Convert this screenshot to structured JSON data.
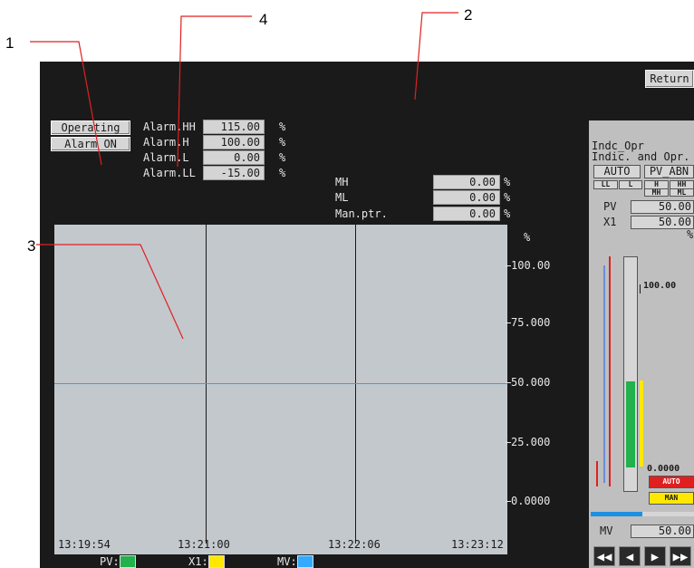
{
  "callouts": {
    "c1": "1",
    "c2": "2",
    "c3": "3",
    "c4": "4"
  },
  "header": {
    "return_label": "Return"
  },
  "status": {
    "operating_label": "Operating",
    "alarm_on_label": "Alarm ON"
  },
  "alarms": [
    {
      "label": "Alarm.HH",
      "value": "115.00",
      "unit": "%"
    },
    {
      "label": "Alarm.H",
      "value": "100.00",
      "unit": "%"
    },
    {
      "label": "Alarm.L",
      "value": "0.00",
      "unit": "%"
    },
    {
      "label": "Alarm.LL",
      "value": "-15.00",
      "unit": "%"
    }
  ],
  "limits": [
    {
      "label": "MH",
      "value": "0.00",
      "unit": "%"
    },
    {
      "label": "ML",
      "value": "0.00",
      "unit": "%"
    },
    {
      "label": "Man.ptr.",
      "value": "0.00",
      "unit": "%"
    }
  ],
  "trend": {
    "y_unit": "%",
    "y_ticks": [
      "100.00",
      "75.000",
      "50.000",
      "25.000",
      "0.0000"
    ],
    "x_ticks": [
      "13:19:54",
      "13:21:00",
      "13:22:06",
      "13:23:12"
    ],
    "mv_line_value": 50
  },
  "legend": [
    {
      "label": "PV:",
      "color": "#22b14c"
    },
    {
      "label": "X1:",
      "color": "#ffe800"
    },
    {
      "label": "MV:",
      "color": "#33aaff"
    }
  ],
  "side": {
    "title1": "Indc_Opr",
    "title2": "Indic. and Opr.",
    "auto_label": "AUTO",
    "pv_abn_label": "PV_ABN",
    "ll_label": "LL",
    "l_label": "L",
    "h_label": "H",
    "hh_label": "HH",
    "mh_label": "MH",
    "ml_label": "ML",
    "pv_label": "PV",
    "pv_value": "50.00",
    "x1_label": "X1",
    "x1_value": "50.00",
    "pct": "%",
    "bar_top": "100.00",
    "bar_bottom": "0.0000",
    "auto_btn": "AUTO",
    "man_btn": "MAN",
    "mv_label": "MV",
    "mv_value": "50.00",
    "pv_level": 0.5,
    "x1_level": 0.5,
    "nav": [
      "◀◀",
      "◀",
      "▶",
      "▶▶"
    ]
  }
}
